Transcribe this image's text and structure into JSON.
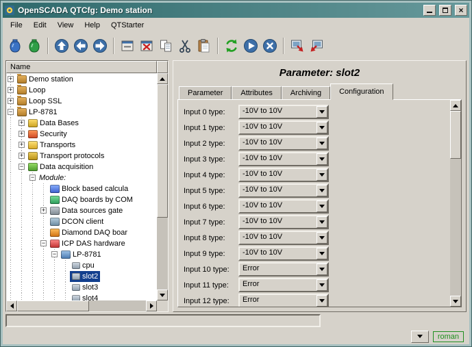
{
  "window": {
    "title": "OpenSCADA QTCfg: Demo station"
  },
  "colors": {
    "titlebar": "#2e696b",
    "selection": "#123f8e",
    "status_user_green": "#1e8e1e"
  },
  "menu": {
    "items": [
      "File",
      "Edit",
      "View",
      "Help",
      "QTStarter"
    ]
  },
  "toolbar": {
    "buttons": [
      {
        "name": "load",
        "icon": "load"
      },
      {
        "name": "save",
        "icon": "save"
      },
      {
        "sep": true
      },
      {
        "name": "up",
        "icon": "up"
      },
      {
        "name": "back",
        "icon": "back"
      },
      {
        "name": "forward",
        "icon": "forward"
      },
      {
        "sep": true
      },
      {
        "name": "add-item",
        "icon": "add-item"
      },
      {
        "name": "delete-item",
        "icon": "delete-item"
      },
      {
        "name": "copy-item",
        "icon": "copy"
      },
      {
        "name": "cut-item",
        "icon": "cut"
      },
      {
        "name": "paste-item",
        "icon": "paste"
      },
      {
        "sep": true
      },
      {
        "name": "refresh",
        "icon": "refresh"
      },
      {
        "name": "start-update",
        "icon": "start"
      },
      {
        "name": "stop-update",
        "icon": "stop"
      },
      {
        "sep": true
      },
      {
        "name": "export",
        "icon": "export"
      },
      {
        "name": "import",
        "icon": "import"
      }
    ]
  },
  "tree": {
    "header": "Name",
    "items": [
      {
        "label": "Demo station",
        "level": 0,
        "expander": "plus",
        "icon": "station"
      },
      {
        "label": "Loop",
        "level": 0,
        "expander": "plus",
        "icon": "station"
      },
      {
        "label": "Loop SSL",
        "level": 0,
        "expander": "plus",
        "icon": "station"
      },
      {
        "label": "LP-8781",
        "level": 0,
        "expander": "minus",
        "icon": "station"
      },
      {
        "label": "Data Bases",
        "level": 1,
        "expander": "plus",
        "icon": "databases"
      },
      {
        "label": "Security",
        "level": 1,
        "expander": "plus",
        "icon": "security"
      },
      {
        "label": "Transports",
        "level": 1,
        "expander": "plus",
        "icon": "transports"
      },
      {
        "label": "Transport protocols",
        "level": 1,
        "expander": "plus",
        "icon": "protocols"
      },
      {
        "label": "Data acquisition",
        "level": 1,
        "expander": "minus",
        "icon": "daq"
      },
      {
        "label": "Module:",
        "level": 2,
        "expander": "minus",
        "italic": true
      },
      {
        "label": "Block based calcula",
        "level": 3,
        "icon": "block"
      },
      {
        "label": "DAQ boards by COM",
        "level": 3,
        "icon": "daqboard"
      },
      {
        "label": "Data sources gate",
        "level": 3,
        "expander": "plus",
        "icon": "gate"
      },
      {
        "label": "DCON client",
        "level": 3,
        "icon": "dcon"
      },
      {
        "label": "Diamond DAQ boar",
        "level": 3,
        "icon": "diamond"
      },
      {
        "label": "ICP DAS hardware",
        "level": 3,
        "expander": "minus",
        "icon": "icpdas"
      },
      {
        "label": "LP-8781",
        "level": 4,
        "expander": "minus",
        "icon": "controller"
      },
      {
        "label": "cpu",
        "level": 5,
        "icon": "param"
      },
      {
        "label": "slot2",
        "level": 5,
        "icon": "param",
        "selected": true
      },
      {
        "label": "slot3",
        "level": 5,
        "icon": "param"
      },
      {
        "label": "slot4",
        "level": 5,
        "icon": "param"
      }
    ]
  },
  "main": {
    "title": "Parameter: slot2",
    "tabs": [
      "Parameter",
      "Attributes",
      "Archiving",
      "Configuration"
    ],
    "active_tab": 3,
    "rows": [
      {
        "label": "Input 0 type:",
        "value": "-10V to 10V"
      },
      {
        "label": "Input 1 type:",
        "value": "-10V to 10V"
      },
      {
        "label": "Input 2 type:",
        "value": "-10V to 10V"
      },
      {
        "label": "Input 3 type:",
        "value": "-10V to 10V"
      },
      {
        "label": "Input 4 type:",
        "value": "-10V to 10V"
      },
      {
        "label": "Input 5 type:",
        "value": "-10V to 10V"
      },
      {
        "label": "Input 6 type:",
        "value": "-10V to 10V"
      },
      {
        "label": "Input 7 type:",
        "value": "-10V to 10V"
      },
      {
        "label": "Input 8 type:",
        "value": "-10V to 10V"
      },
      {
        "label": "Input 9 type:",
        "value": "-10V to 10V"
      },
      {
        "label": "Input 10 type:",
        "value": "Error"
      },
      {
        "label": "Input 11 type:",
        "value": "Error"
      },
      {
        "label": "Input 12 type:",
        "value": "Error"
      }
    ]
  },
  "statusbar": {
    "user": "roman"
  }
}
